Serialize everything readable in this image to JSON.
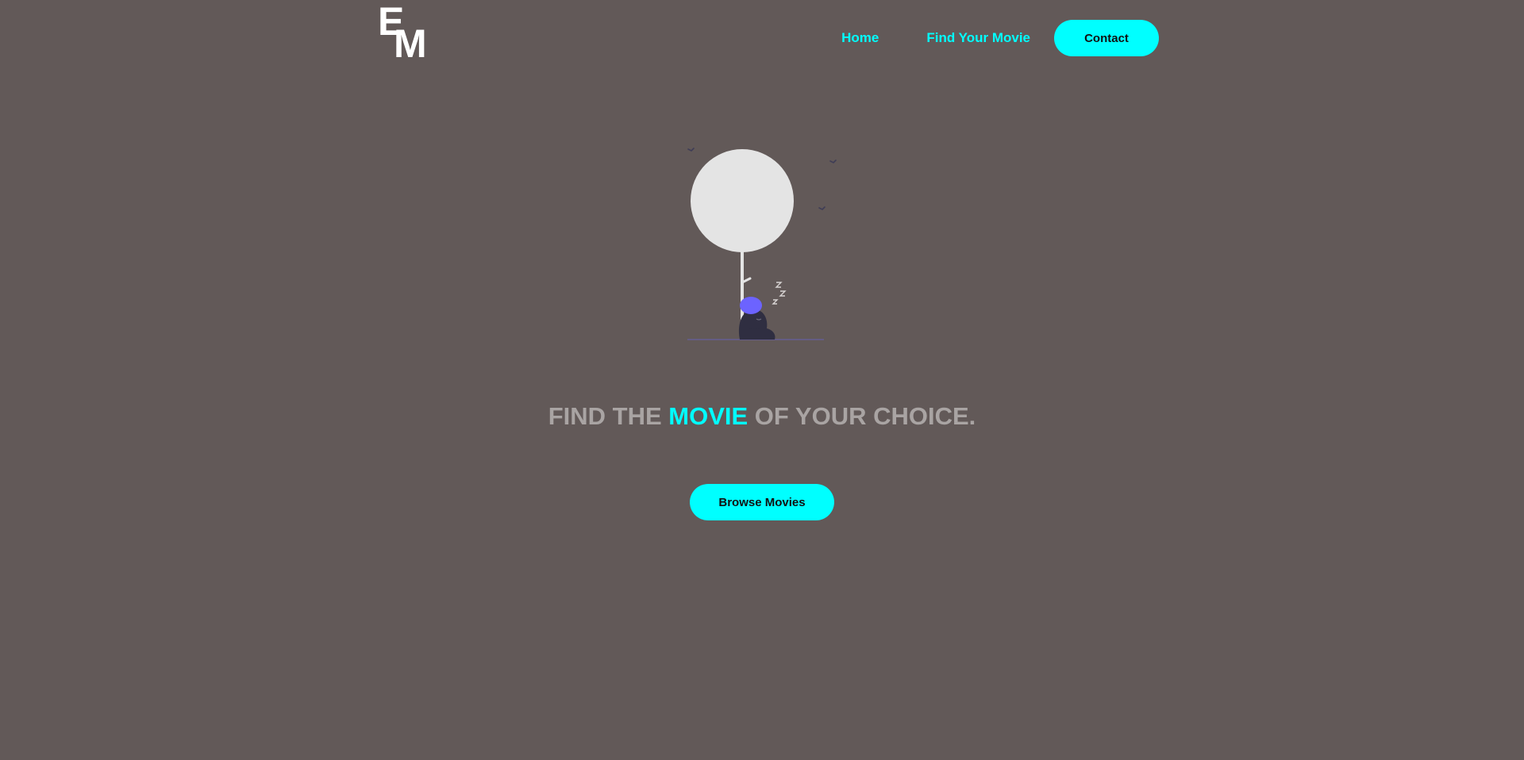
{
  "brand": {
    "logo_letter_1": "E",
    "logo_letter_2": "M"
  },
  "nav": {
    "home_label": "Home",
    "find_label": "Find Your Movie",
    "contact_label": "Contact"
  },
  "hero": {
    "headline_before": "FIND THE ",
    "headline_accent": "MOVIE",
    "headline_after": " OF YOUR CHOICE.",
    "cta_label": "Browse Movies",
    "illustration_icon": "sleeping-under-tree-illustration"
  },
  "colors": {
    "background": "#625958",
    "accent": "#00ffff",
    "headline_text": "#a9a4a3",
    "figure_hat": "#6c63ff",
    "figure_body": "#2f2e41"
  }
}
